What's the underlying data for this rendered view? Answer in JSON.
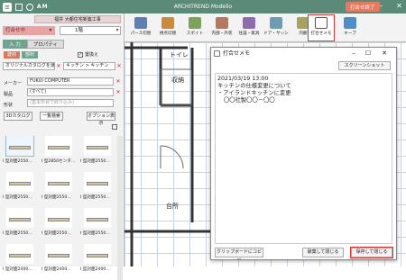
{
  "app": {
    "qa_label": "AM",
    "title": "ARCHITREND Modelio",
    "meeting_end": "打合せ終了",
    "min": "–",
    "max": "☐",
    "close": "✕"
  },
  "left": {
    "project_name": "福井 大都住宅新築工事",
    "meeting_status": "打合せ中",
    "floor": "1階",
    "tabs": [
      "入 力",
      "プロパティ"
    ],
    "subtabs": [
      "建材",
      "部材"
    ],
    "replace_check": "置換え",
    "catalog": "オリジナルカタログを選択>",
    "category": "キッチン > キッチン",
    "maker_label": "メーカー",
    "maker_value": "FUKUI COMPUTER",
    "product_label": "製品",
    "product_value": "(すべて)",
    "shape_label": "形状",
    "shape_placeholder": "(基本形状で絞り込み)",
    "catalog_btn": "3Dカタログ",
    "list_btn": "一覧検索",
    "option_btn": "オプション表示",
    "items": [
      "I 型対面2550...",
      "I 型2850センタ...",
      "I 型対面2550...",
      "I 型対面2550...",
      "I 型対面2550...",
      "I 型対面2550...",
      "I 型対面2550...",
      "I 型対面2550...",
      "I 型対面2550...",
      "I 型対面2400...",
      "I 型対面2400...",
      "I 型対面2400..."
    ]
  },
  "ribbon": [
    {
      "label": "パース切替",
      "color": "#5d7fb5"
    },
    {
      "label": "視点切替",
      "color": "#c98c3c"
    },
    {
      "label": "スポイト",
      "color": "#7da35a"
    },
    {
      "label": "内部・外装",
      "color": "#b5785d"
    },
    {
      "label": "住設・家具",
      "color": "#8f6bb3"
    },
    {
      "label": "ドア・サッシ",
      "color": "#6d9eb0"
    },
    {
      "label": "内観",
      "color": "#a8a35a"
    },
    {
      "label": "打合せメモ",
      "color": "#555555"
    },
    {
      "label": "キープ",
      "color": "#4d8fc9"
    }
  ],
  "canvas": {
    "rooms": [
      "トイレ",
      "収納",
      "台所"
    ]
  },
  "dialog": {
    "title": "打合せメモ",
    "screenshot_btn": "スクリーンショット",
    "memo_lines": [
      "2021/03/19 13:00",
      "キッチンの仕様変更について",
      "・アイランドキッチンに変更",
      "  〇〇社製〇〇－〇〇"
    ],
    "clipboard_btn": "クリップボードにコピー",
    "close_discard_btn": "破棄して閉じる",
    "save_close_btn": "保存して閉じる"
  }
}
